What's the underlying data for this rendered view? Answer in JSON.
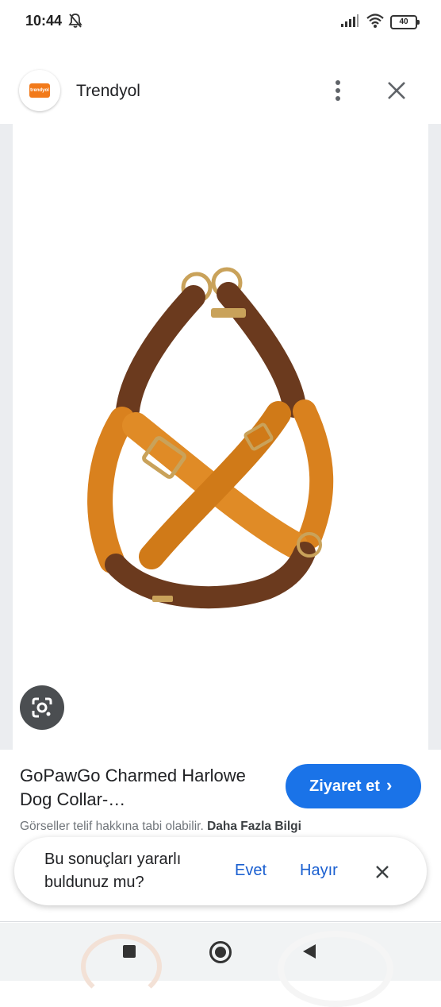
{
  "status_bar": {
    "time": "10:44",
    "battery": "40"
  },
  "header": {
    "site_name": "Trendyol",
    "logo_text": "trendyol"
  },
  "result": {
    "title": "GoPawGo Charmed Harlowe Dog Collar-…",
    "visit_label": "Ziyaret et",
    "copyright_prefix": "Görseller telif hakkına tabi olabilir.",
    "copyright_link": "Daha Fazla Bilgi"
  },
  "feedback": {
    "question": "Bu sonuçları yararlı buldunuz mu?",
    "yes_label": "Evet",
    "no_label": "Hayır"
  },
  "icons": {
    "status": [
      "mute-icon",
      "signal-icon",
      "wifi-icon",
      "battery-icon"
    ],
    "header": [
      "more-vert-icon",
      "close-icon"
    ],
    "image": [
      "google-lens-icon"
    ],
    "nav": [
      "recents-icon",
      "home-icon",
      "back-icon"
    ]
  },
  "colors": {
    "accent_blue": "#1a73e8",
    "brand_orange": "#f27a1a",
    "harness_orange": "#d9811e",
    "harness_brown": "#6b3a1e",
    "hardware_gold": "#c9a25a"
  }
}
